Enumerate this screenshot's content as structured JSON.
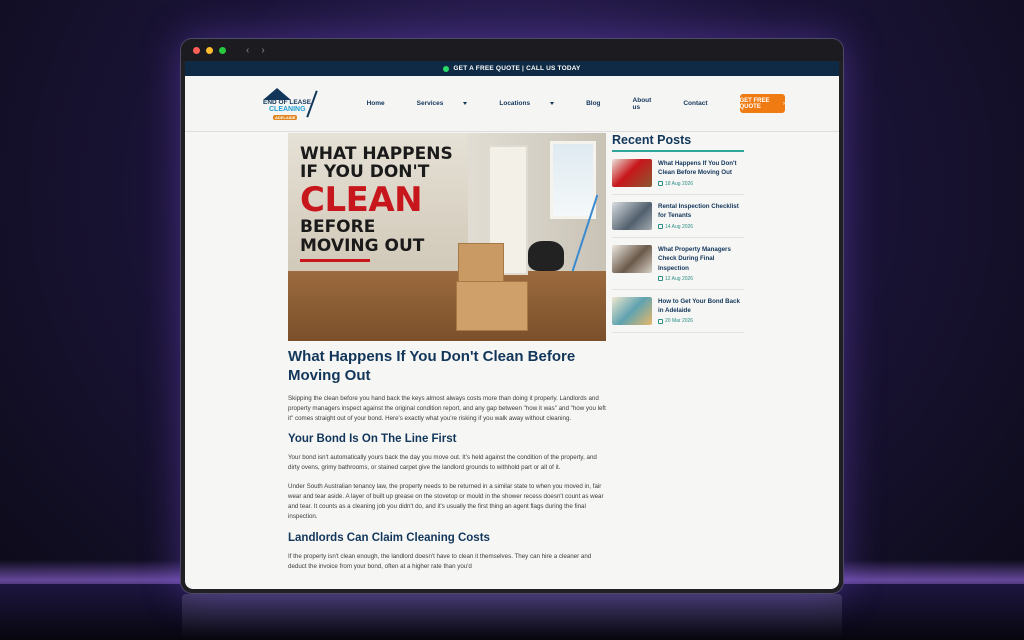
{
  "browser": {
    "back": "‹",
    "forward": "›"
  },
  "topbar": {
    "text": "GET A FREE QUOTE | CALL US TODAY"
  },
  "logo": {
    "line1": "END OF LEASE",
    "line2": "CLEANING",
    "line3": "ADELAIDE"
  },
  "nav": {
    "items": [
      "Home",
      "Services",
      "Locations",
      "Blog",
      "About us",
      "Contact"
    ]
  },
  "cta": {
    "label": "GET FREE QUOTE",
    "arrow": "›"
  },
  "hero": {
    "line1": "WHAT HAPPENS",
    "line2": "IF YOU DON'T",
    "line3": "CLEAN",
    "line4": "BEFORE",
    "line5": "MOVING OUT"
  },
  "article": {
    "title": "What Happens If You Don't Clean Before Moving Out",
    "intro": "Skipping the clean before you hand back the keys almost always costs more than doing it properly. Landlords and property managers inspect against the original condition report, and any gap between \"how it was\" and \"how you left it\" comes straight out of your bond. Here's exactly what you're risking if you walk away without cleaning.",
    "h2_1": "Your Bond Is On The Line First",
    "p1": "Your bond isn't automatically yours back the day you move out. It's held against the condition of the property, and dirty ovens, grimy bathrooms, or stained carpet give the landlord grounds to withhold part or all of it.",
    "p2": "Under South Australian tenancy law, the property needs to be returned in a similar state to when you moved in, fair wear and tear aside. A layer of built up grease on the stovetop or mould in the shower recess doesn't count as wear and tear. It counts as a cleaning job you didn't do, and it's usually the first thing an agent flags during the final inspection.",
    "h2_2": "Landlords Can Claim Cleaning Costs",
    "p3": "If the property isn't clean enough, the landlord doesn't have to clean it themselves. They can hire a cleaner and deduct the invoice from your bond, often at a higher rate than you'd"
  },
  "sidebar": {
    "heading": "Recent Posts",
    "posts": [
      {
        "title": "What Happens If You Don't Clean Before Moving Out",
        "date": "18 Aug 2026"
      },
      {
        "title": "Rental Inspection Checklist for Tenants",
        "date": "14 Aug 2026"
      },
      {
        "title": "What Property Managers Check During Final Inspection",
        "date": "12 Aug 2026"
      },
      {
        "title": "How to Get Your Bond Back in Adelaide",
        "date": "20 Mar 2026"
      }
    ]
  }
}
